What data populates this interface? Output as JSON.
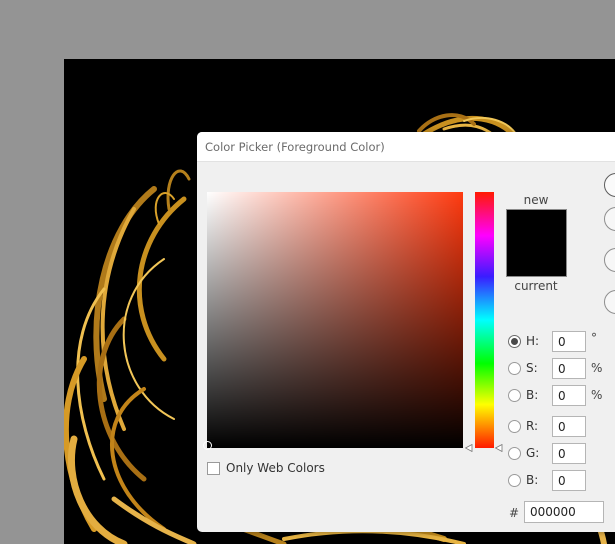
{
  "dialog": {
    "title": "Color Picker (Foreground Color)"
  },
  "swatch": {
    "new_label": "new",
    "current_label": "current",
    "new_color": "#000000",
    "current_color": "#000000"
  },
  "fields": {
    "h": {
      "label": "H:",
      "value": "0",
      "unit": "°",
      "selected": true
    },
    "s": {
      "label": "S:",
      "value": "0",
      "unit": "%"
    },
    "b_hsb": {
      "label": "B:",
      "value": "0",
      "unit": "%"
    },
    "r": {
      "label": "R:",
      "value": "0"
    },
    "g": {
      "label": "G:",
      "value": "0"
    },
    "b_rgb": {
      "label": "B:",
      "value": "0"
    }
  },
  "hex": {
    "prefix": "#",
    "value": "000000"
  },
  "web_colors": {
    "label": "Only Web Colors",
    "checked": false
  },
  "colors": {
    "hue_color": "#ff3a10",
    "hair_gold": "#d9a12a",
    "dialog_bg": "#f0f0f0"
  }
}
